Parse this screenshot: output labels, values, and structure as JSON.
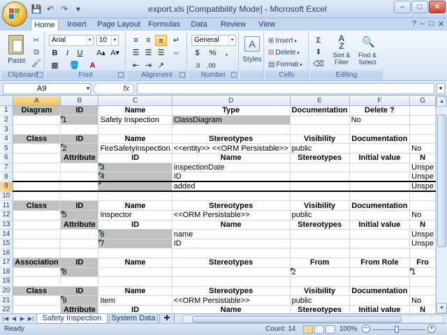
{
  "window": {
    "title": "export.xls  [Compatibility Mode] - Microsoft Excel",
    "controls": [
      "–",
      "□",
      "✕"
    ]
  },
  "qat": {
    "save_icon": "💾",
    "undo_icon": "↶",
    "redo_icon": "↷",
    "customize_icon": "▾"
  },
  "ribbon": {
    "tabs": [
      "Home",
      "Insert",
      "Page Layout",
      "Formulas",
      "Data",
      "Review",
      "View"
    ],
    "active_tab": "Home",
    "right_icons": [
      "?",
      "–",
      "□",
      "✕"
    ],
    "groups": {
      "clipboard": {
        "label": "Clipboard",
        "paste": "Paste"
      },
      "font": {
        "label": "Font",
        "font_name": "Arial",
        "font_size": "10",
        "bold": "B",
        "italic": "I",
        "underline": "U",
        "grow": "A▴",
        "shrink": "A▾"
      },
      "alignment": {
        "label": "Alignment"
      },
      "number": {
        "label": "Number",
        "format": "General",
        "currency": "$",
        "percent": "%",
        "comma": ","
      },
      "styles": {
        "label": "",
        "styles": "Styles"
      },
      "cells": {
        "label": "Cells",
        "insert": "Insert",
        "delete": "Delete",
        "format": "Format"
      },
      "editing": {
        "label": "Editing",
        "sort_filter": "Sort &\nFilter",
        "find_select": "Find &\nSelect"
      }
    }
  },
  "formula_bar": {
    "name_box": "A9",
    "fx": "fx",
    "value": ""
  },
  "sheet": {
    "columns": [
      "A",
      "B",
      "C",
      "D",
      "E",
      "F",
      "G"
    ],
    "selected_col": "A",
    "selected_row": 9,
    "rows": [
      {
        "n": 1,
        "style": "header",
        "cells": [
          "Diagram",
          "ID",
          "Name",
          "Type",
          "Documentation",
          "Delete ?",
          ""
        ]
      },
      {
        "n": 2,
        "style": "data",
        "cells": [
          "",
          "1",
          "Safety Inspection",
          "ClassDiagram",
          "",
          "No",
          ""
        ]
      },
      {
        "n": 3,
        "style": "blank",
        "cells": [
          "",
          "",
          "",
          "",
          "",
          "",
          ""
        ]
      },
      {
        "n": 4,
        "style": "header",
        "cells": [
          "Class",
          "ID",
          "Name",
          "Stereotypes",
          "Visibility",
          "Documentation",
          ""
        ]
      },
      {
        "n": 5,
        "style": "data",
        "cells": [
          "",
          "2",
          "FireSafetyInspection",
          "<<entity>> <<ORM Persistable>>",
          "public",
          "",
          "No"
        ]
      },
      {
        "n": 6,
        "style": "subheader",
        "cells": [
          "",
          "Attribute",
          "ID",
          "Name",
          "Stereotypes",
          "Initial value",
          "N"
        ]
      },
      {
        "n": 7,
        "style": "attr",
        "cells": [
          "",
          "",
          "3",
          "inspectionDate",
          "",
          "",
          "Unspe"
        ]
      },
      {
        "n": 8,
        "style": "attr",
        "cells": [
          "",
          "",
          "4",
          "ID",
          "",
          "",
          "Unspe"
        ]
      },
      {
        "n": 9,
        "style": "attr",
        "cells": [
          "",
          "",
          "",
          "added",
          "",
          "",
          "Unspe"
        ]
      },
      {
        "n": 10,
        "style": "blank",
        "cells": [
          "",
          "",
          "",
          "",
          "",
          "",
          ""
        ]
      },
      {
        "n": 11,
        "style": "header",
        "cells": [
          "Class",
          "ID",
          "Name",
          "Stereotypes",
          "Visibility",
          "Documentation",
          ""
        ]
      },
      {
        "n": 12,
        "style": "data",
        "cells": [
          "",
          "5",
          "Inspector",
          "<<ORM Persistable>>",
          "public",
          "",
          "No"
        ]
      },
      {
        "n": 13,
        "style": "subheader",
        "cells": [
          "",
          "Attribute",
          "ID",
          "Name",
          "Stereotypes",
          "Initial value",
          "N"
        ]
      },
      {
        "n": 14,
        "style": "attr",
        "cells": [
          "",
          "",
          "6",
          "name",
          "",
          "",
          "Unspe"
        ]
      },
      {
        "n": 15,
        "style": "attr",
        "cells": [
          "",
          "",
          "7",
          "ID",
          "",
          "",
          "Unspe"
        ]
      },
      {
        "n": 16,
        "style": "blank",
        "cells": [
          "",
          "",
          "",
          "",
          "",
          "",
          ""
        ]
      },
      {
        "n": 17,
        "style": "header",
        "cells": [
          "Association",
          "ID",
          "Name",
          "Stereotypes",
          "From",
          "From Role",
          "Fro"
        ]
      },
      {
        "n": 18,
        "style": "assoc",
        "cells": [
          "",
          "8",
          "",
          "",
          "2",
          "",
          "1"
        ]
      },
      {
        "n": 19,
        "style": "blank",
        "cells": [
          "",
          "",
          "",
          "",
          "",
          "",
          ""
        ]
      },
      {
        "n": 20,
        "style": "header",
        "cells": [
          "Class",
          "ID",
          "Name",
          "Stereotypes",
          "Visibility",
          "Documentation",
          ""
        ]
      },
      {
        "n": 21,
        "style": "data",
        "cells": [
          "",
          "9",
          "Item",
          "<<ORM Persistable>>",
          "public",
          "",
          "No"
        ]
      },
      {
        "n": 22,
        "style": "subheader",
        "cells": [
          "",
          "Attribute",
          "ID",
          "Name",
          "Stereotypes",
          "Initial value",
          "N"
        ]
      }
    ]
  },
  "sheet_tabs": [
    "Safety Inspection",
    "System Data"
  ],
  "active_sheet": "Safety Inspection",
  "status": {
    "ready": "Ready",
    "count": "Count: 14",
    "zoom": "100%"
  }
}
